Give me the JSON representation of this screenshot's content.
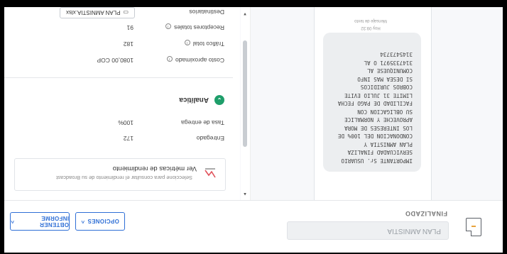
{
  "header": {
    "name_value": "PLAN AMNISTIA",
    "status": "FINALIZADO",
    "opciones_label": "OPCIONES",
    "informe_label": "OBTENER INFORME"
  },
  "message": {
    "lines": [
      "IMPORTANTE Sr. USUARIO",
      "SERVICUADAD FINALIZA",
      "PLAN AMNISTIA Y",
      "CONDONACION DEL 100% DE",
      "LOS INTERESES DE MORA",
      "APROVECHE Y NORMALICE",
      "SU OBLIGACION CON",
      "FACILIDAD DE PAGO FECHA",
      "LIMITE 31 JULIO EVITE",
      "COBROS JURIDICOS",
      "SI DESEA MAS INFO",
      "COMUNIQUESE AL",
      "3147335971 O AL",
      "3145473734"
    ],
    "time": "Hoy 09:32",
    "type": "Mensaje de texto"
  },
  "metrics": {
    "title": "Ver métricas de rendimiento",
    "subtitle": "Seleccione para consultar el rendimiento de su Broadcast"
  },
  "stats": {
    "entregado_label": "Entregado",
    "entregado_value": "172",
    "tasa_label": "Tasa de entrega",
    "tasa_value": "100%"
  },
  "analytics_label": "Analítica",
  "costs": {
    "costo_label": "Costo aproximado",
    "costo_value": "1080,00 COP",
    "trafico_label": "Tráfico total",
    "trafico_value": "182",
    "receptores_label": "Receptores totales",
    "receptores_value": "91",
    "destinatarios_label": "Destinatarios",
    "file_name": "PLAN AMNISTIA.xlsx"
  },
  "colors": {
    "accent": "#2f6fd6",
    "success": "#1e9e6a"
  }
}
